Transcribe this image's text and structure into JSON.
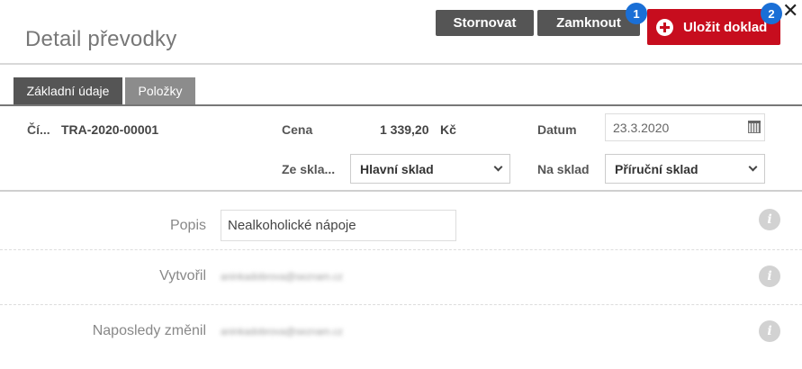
{
  "header": {
    "title": "Detail převodky",
    "cancel_label": "Stornovat",
    "lock_label": "Zamknout",
    "save_label": "Uložit doklad",
    "badge_1": "1",
    "badge_2": "2",
    "close_glyph": "✕"
  },
  "tabs": [
    {
      "label": "Základní údaje",
      "active": true
    },
    {
      "label": "Položky",
      "active": false
    }
  ],
  "summary": {
    "number_label": "Čí...",
    "number_value": "TRA-2020-00001",
    "price_label": "Cena",
    "price_value": "1 339,20",
    "currency": "Kč",
    "date_label": "Datum",
    "date_value": "23.3.2020",
    "from_label": "Ze skla...",
    "from_value": "Hlavní sklad",
    "to_label": "Na sklad",
    "to_value": "Příruční sklad"
  },
  "details": {
    "description_label": "Popis",
    "description_value": "Nealkoholické nápoje",
    "created_label": "Vytvořil",
    "created_value": "aninkadobrova@seznam.cz",
    "modified_label": "Naposledy změnil",
    "modified_value": "aninkadobrova@seznam.cz",
    "info_glyph": "i"
  },
  "colors": {
    "save_button": "#c70d1e",
    "dark_button": "#555555",
    "badge": "#1a6fd6",
    "active_tab": "#555555",
    "inactive_tab": "#8c8c8c"
  },
  "icons": [
    "close-icon",
    "plus-circle-icon",
    "calendar-icon",
    "chevron-down-icon",
    "info-icon"
  ]
}
